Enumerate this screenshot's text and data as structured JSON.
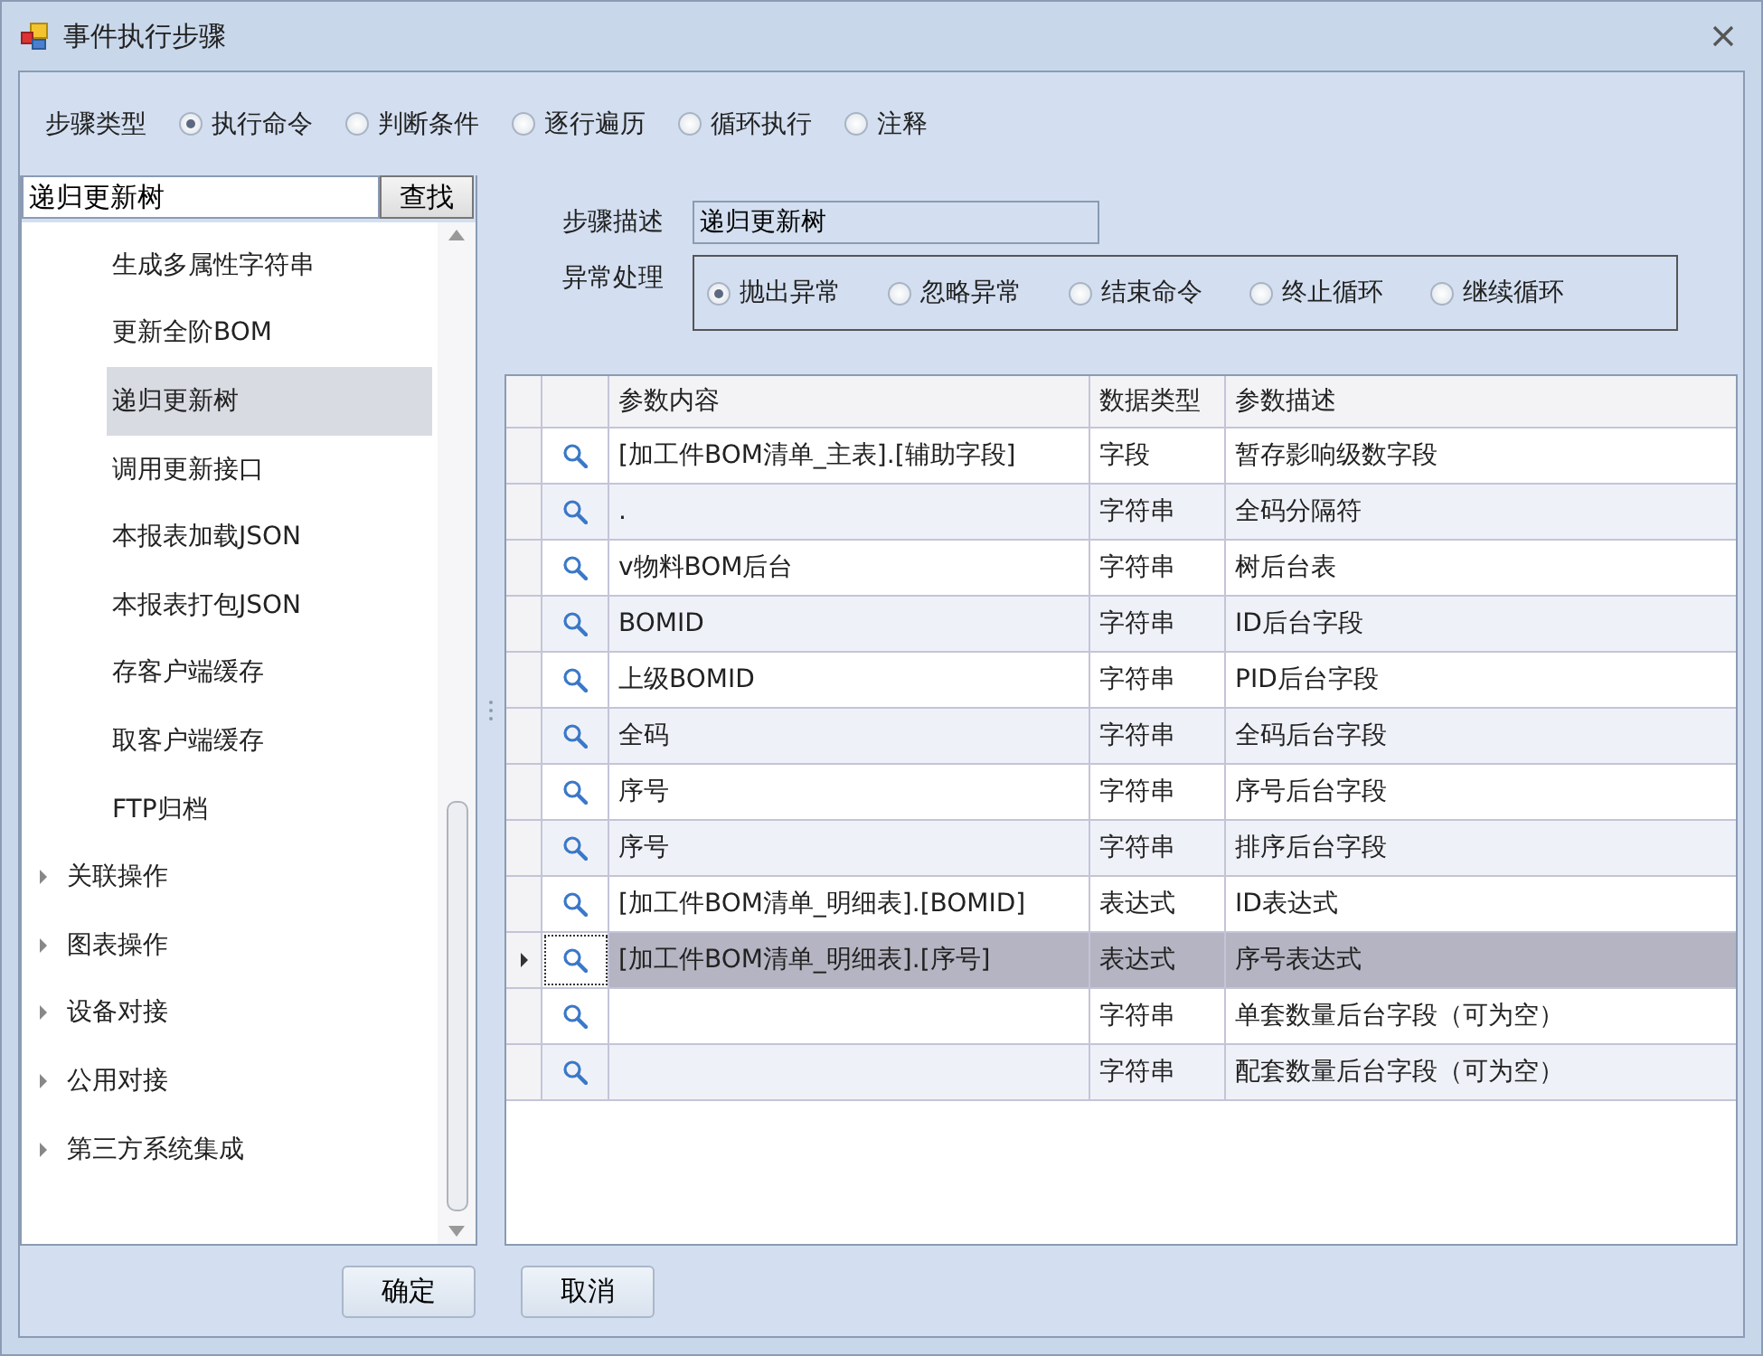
{
  "window": {
    "title": "事件执行步骤"
  },
  "step_type": {
    "label": "步骤类型",
    "options": [
      {
        "label": "执行命令",
        "selected": true
      },
      {
        "label": "判断条件",
        "selected": false
      },
      {
        "label": "逐行遍历",
        "selected": false
      },
      {
        "label": "循环执行",
        "selected": false
      },
      {
        "label": "注释",
        "selected": false
      }
    ]
  },
  "search": {
    "value": "递归更新树",
    "button": "查找"
  },
  "tree": {
    "items": [
      {
        "children": [
          {
            "label": "生成多属性字符串",
            "selected": false
          },
          {
            "label": "更新全阶BOM",
            "selected": false
          },
          {
            "label": "递归更新树",
            "selected": true
          },
          {
            "label": "调用更新接口",
            "selected": false
          },
          {
            "label": "本报表加载JSON",
            "selected": false
          },
          {
            "label": "本报表打包JSON",
            "selected": false
          },
          {
            "label": "存客户端缓存",
            "selected": false
          },
          {
            "label": "取客户端缓存",
            "selected": false
          },
          {
            "label": "FTP归档",
            "selected": false
          }
        ]
      },
      {
        "label": "关联操作",
        "expanded": false,
        "selected": false
      },
      {
        "label": "图表操作",
        "expanded": false,
        "selected": false
      },
      {
        "label": "设备对接",
        "expanded": false,
        "selected": false
      },
      {
        "label": "公用对接",
        "expanded": false,
        "selected": false
      },
      {
        "label": "第三方系统集成",
        "expanded": false,
        "selected": false
      }
    ]
  },
  "step_description": {
    "label": "步骤描述",
    "value": "递归更新树"
  },
  "exception_handling": {
    "label": "异常处理",
    "options": [
      {
        "label": "抛出异常",
        "selected": true
      },
      {
        "label": "忽略异常",
        "selected": false
      },
      {
        "label": "结束命令",
        "selected": false
      },
      {
        "label": "终止循环",
        "selected": false
      },
      {
        "label": "继续循环",
        "selected": false
      }
    ]
  },
  "table": {
    "columns": [
      "参数内容",
      "数据类型",
      "参数描述"
    ],
    "rows": [
      {
        "content": "[加工件BOM清单_主表].[辅助字段]",
        "type": "字段",
        "description": "暂存影响级数字段",
        "selected": false
      },
      {
        "content": ".",
        "type": "字符串",
        "description": "全码分隔符",
        "selected": false
      },
      {
        "content": "v物料BOM后台",
        "type": "字符串",
        "description": "树后台表",
        "selected": false
      },
      {
        "content": "BOMID",
        "type": "字符串",
        "description": "ID后台字段",
        "selected": false
      },
      {
        "content": "上级BOMID",
        "type": "字符串",
        "description": "PID后台字段",
        "selected": false
      },
      {
        "content": "全码",
        "type": "字符串",
        "description": "全码后台字段",
        "selected": false
      },
      {
        "content": "序号",
        "type": "字符串",
        "description": "序号后台字段",
        "selected": false
      },
      {
        "content": "序号",
        "type": "字符串",
        "description": "排序后台字段",
        "selected": false
      },
      {
        "content": "[加工件BOM清单_明细表].[BOMID]",
        "type": "表达式",
        "description": "ID表达式",
        "selected": false
      },
      {
        "content": "[加工件BOM清单_明细表].[序号]",
        "type": "表达式",
        "description": "序号表达式",
        "selected": true
      },
      {
        "type": "字符串",
        "description": "单套数量后台字段（可为空）",
        "selected": false
      },
      {
        "type": "字符串",
        "description": "配套数量后台字段（可为空）",
        "selected": false
      }
    ]
  },
  "buttons": [
    "确定",
    "取消"
  ]
}
